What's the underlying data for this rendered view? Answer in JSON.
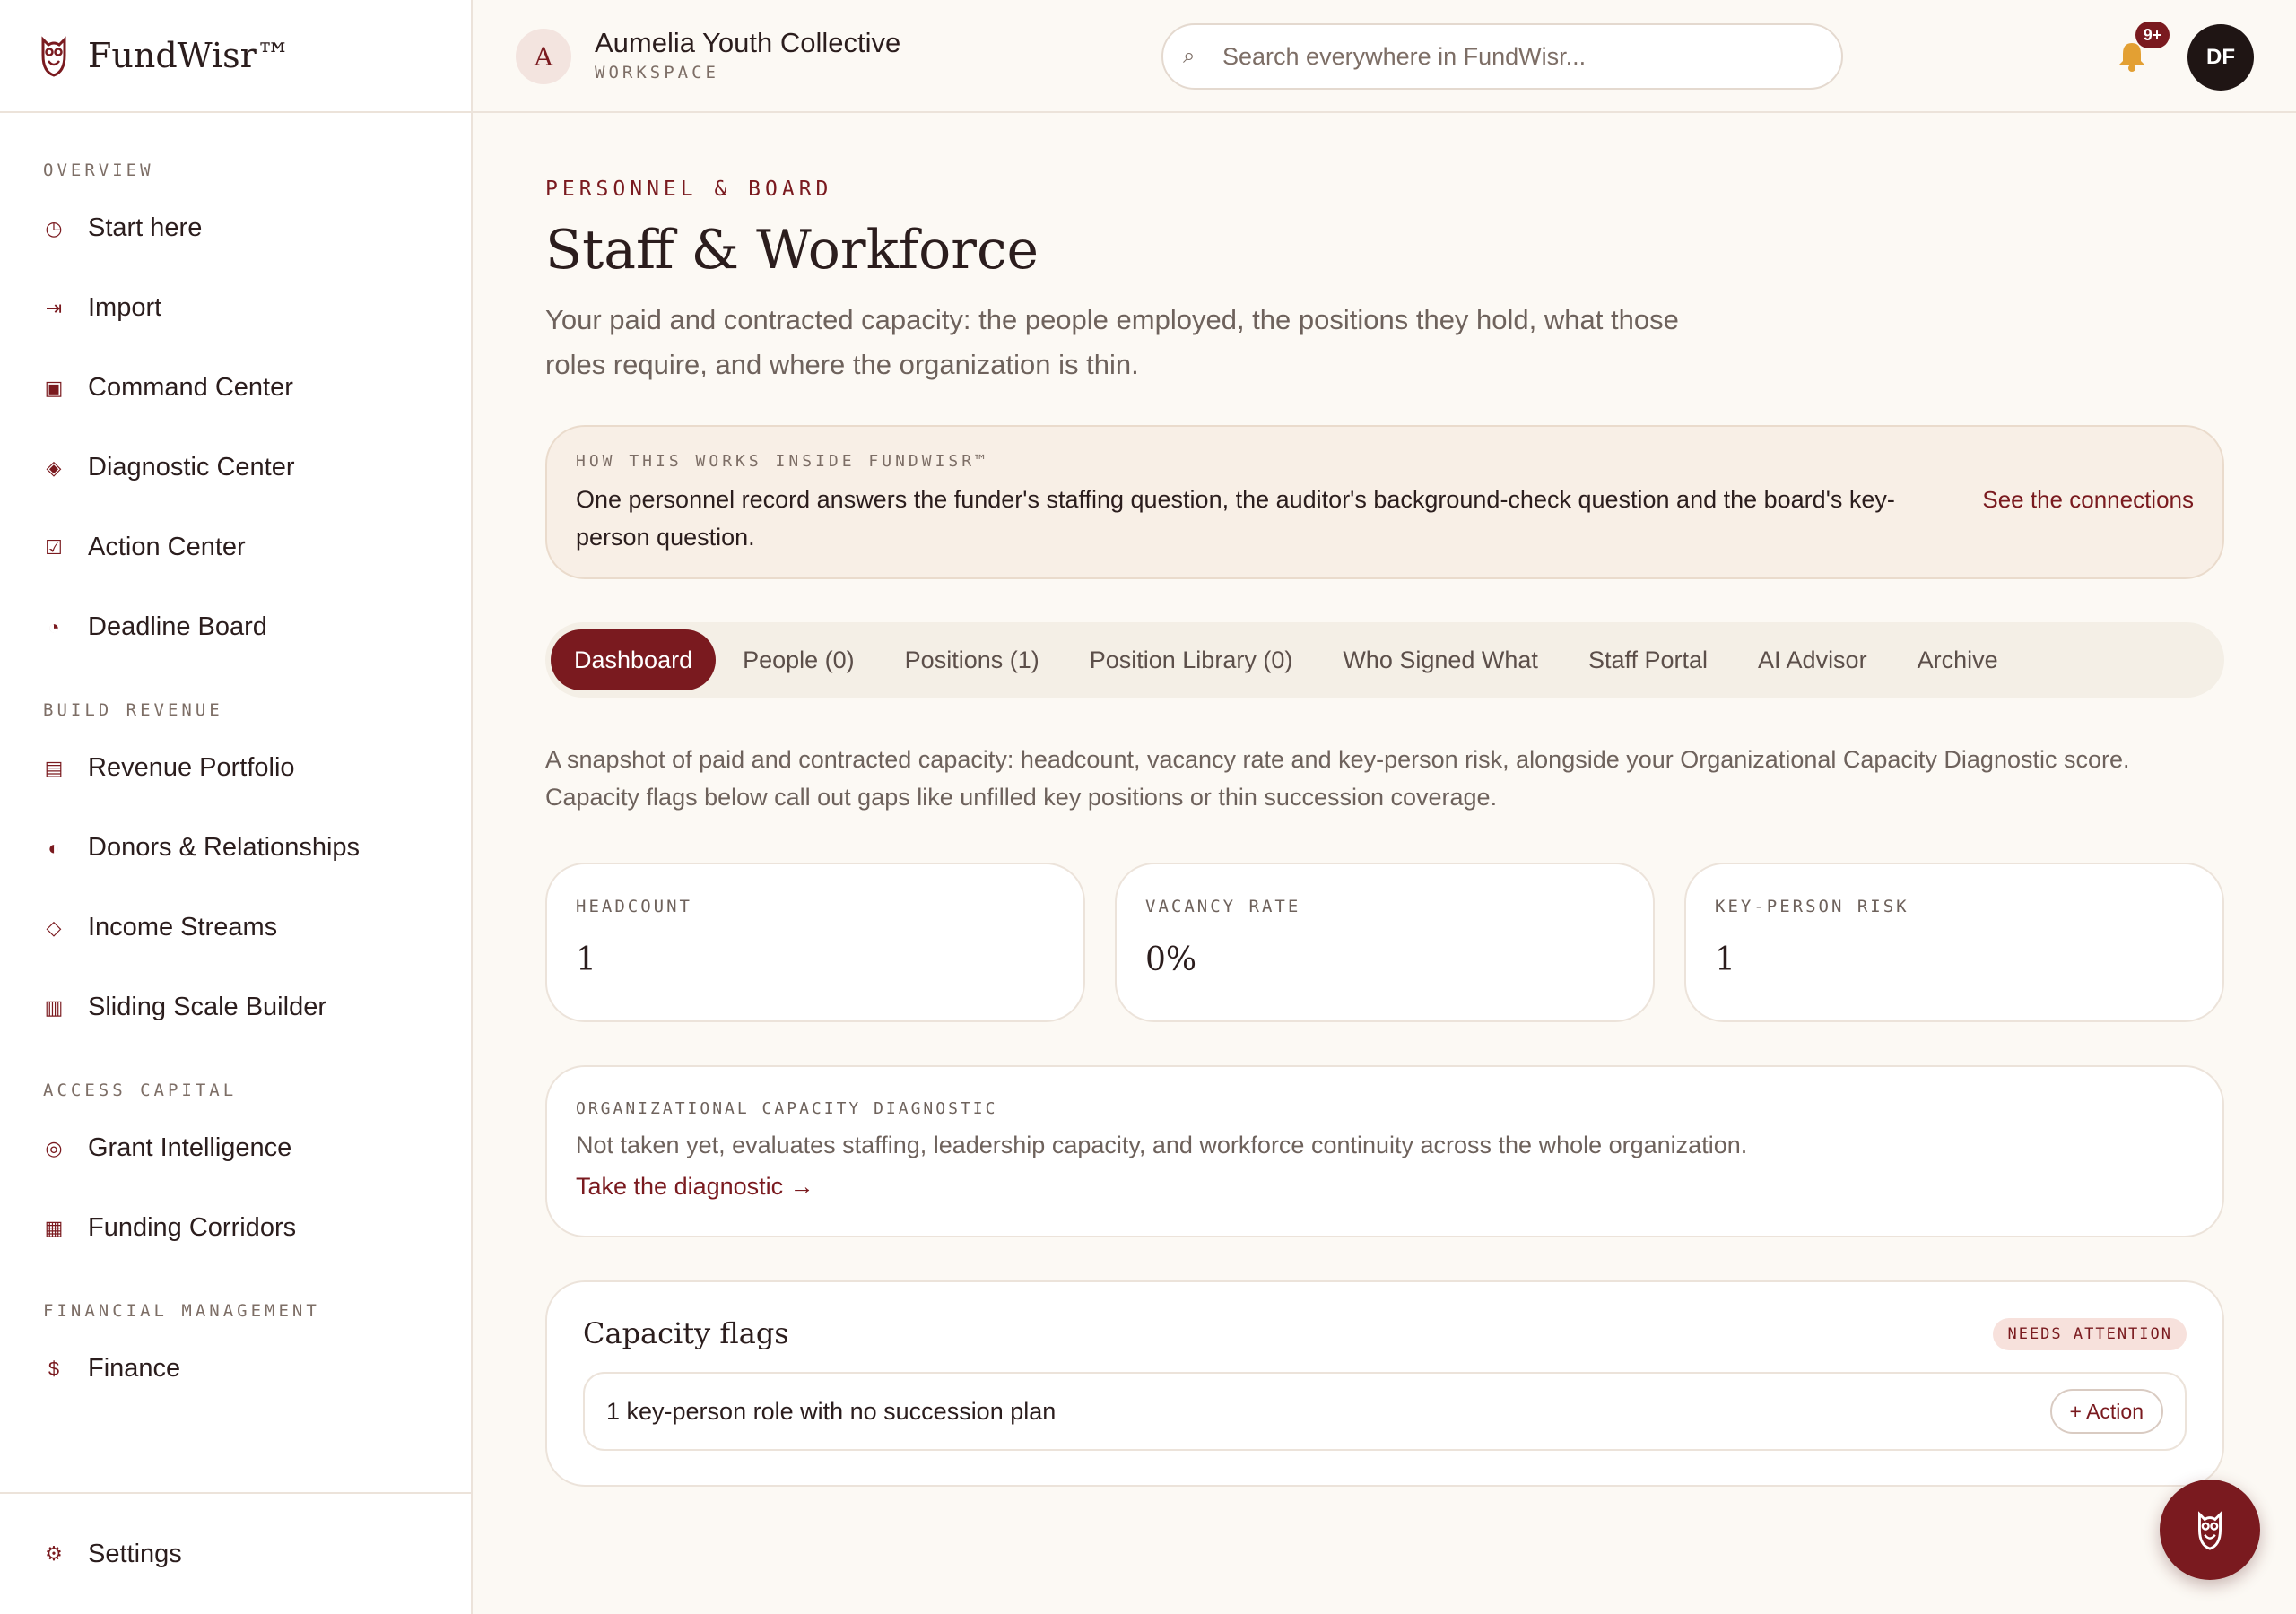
{
  "brand": {
    "name": "FundWisr™"
  },
  "sidebar": {
    "sections": [
      {
        "label": "OVERVIEW",
        "items": [
          {
            "label": "Start here",
            "icon": "clock-icon"
          },
          {
            "label": "Import",
            "icon": "import-arrow-icon"
          },
          {
            "label": "Command Center",
            "icon": "square-icon"
          },
          {
            "label": "Diagnostic Center",
            "icon": "diamond-icon"
          },
          {
            "label": "Action Center",
            "icon": "checkbox-icon"
          },
          {
            "label": "Deadline Board",
            "icon": "pie-icon"
          }
        ]
      },
      {
        "label": "BUILD REVENUE",
        "items": [
          {
            "label": "Revenue Portfolio",
            "icon": "list-icon"
          },
          {
            "label": "Donors & Relationships",
            "icon": "half-circle-icon"
          },
          {
            "label": "Income Streams",
            "icon": "diamond-outline-icon"
          },
          {
            "label": "Sliding Scale Builder",
            "icon": "columns-icon"
          }
        ]
      },
      {
        "label": "ACCESS CAPITAL",
        "items": [
          {
            "label": "Grant Intelligence",
            "icon": "target-icon"
          },
          {
            "label": "Funding Corridors",
            "icon": "grid-icon"
          }
        ]
      },
      {
        "label": "FINANCIAL MANAGEMENT",
        "items": [
          {
            "label": "Finance",
            "icon": "dollar-icon"
          }
        ]
      }
    ],
    "footer": {
      "label": "Settings",
      "icon": "gear-icon"
    }
  },
  "topbar": {
    "workspace_initial": "A",
    "workspace_name": "Aumelia Youth Collective",
    "workspace_sub": "WORKSPACE",
    "search_placeholder": "Search everywhere in FundWisr...",
    "notification_count": "9+",
    "user_initials": "DF"
  },
  "page": {
    "eyebrow": "PERSONNEL & BOARD",
    "title": "Staff & Workforce",
    "description": "Your paid and contracted capacity: the people employed, the positions they hold, what those roles require, and where the organization is thin."
  },
  "info": {
    "label": "HOW THIS WORKS INSIDE FUNDWISR™",
    "text": "One personnel record answers the funder's staffing question, the auditor's background-check question and the board's key-person question.",
    "link": "See the connections"
  },
  "tabs": [
    {
      "label": "Dashboard",
      "active": true
    },
    {
      "label": "People (0)"
    },
    {
      "label": "Positions (1)"
    },
    {
      "label": "Position Library (0)"
    },
    {
      "label": "Who Signed What"
    },
    {
      "label": "Staff Portal"
    },
    {
      "label": "AI Advisor"
    },
    {
      "label": "Archive"
    }
  ],
  "dashboard": {
    "description": "A snapshot of paid and contracted capacity: headcount, vacancy rate and key-person risk, alongside your Organizational Capacity Diagnostic score. Capacity flags below call out gaps like unfilled key positions or thin succession coverage.",
    "metrics": [
      {
        "label": "HEADCOUNT",
        "value": "1"
      },
      {
        "label": "VACANCY RATE",
        "value": "0%"
      },
      {
        "label": "KEY-PERSON RISK",
        "value": "1"
      }
    ],
    "diagnostic": {
      "label": "ORGANIZATIONAL CAPACITY DIAGNOSTIC",
      "text": "Not taken yet, evaluates staffing, leadership capacity, and workforce continuity across the whole organization.",
      "link": "Take the diagnostic →"
    },
    "flags": {
      "title": "Capacity flags",
      "status": "NEEDS ATTENTION",
      "items": [
        {
          "text": "1 key-person role with no succession plan",
          "action": "+ Action"
        }
      ]
    }
  },
  "colors": {
    "accent": "#7a1a1f",
    "background": "#fcf9f4",
    "bell": "#e3a033"
  }
}
